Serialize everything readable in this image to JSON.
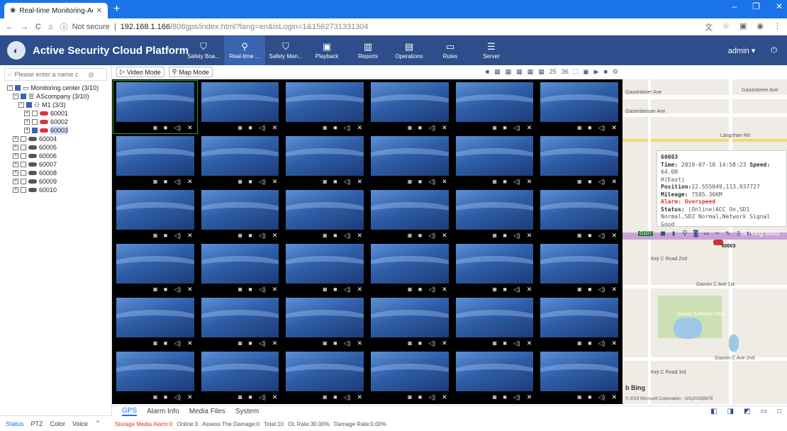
{
  "browser": {
    "tab_title": "Real-time Monitoring-Active S",
    "new_tab": "+",
    "security": "Not secure",
    "url_host": "192.168.1.166",
    "url_path": "/808gps/index.html?lang=en&isLogin=1&1562731331304"
  },
  "header": {
    "brand": "Active Security Cloud Platform",
    "nav": [
      {
        "label": "Safety Boa...",
        "icon": "shield-icon"
      },
      {
        "label": "Real-time ...",
        "icon": "location-pin-icon"
      },
      {
        "label": "Safety Man...",
        "icon": "shield-play-icon"
      },
      {
        "label": "Playback",
        "icon": "playback-icon"
      },
      {
        "label": "Reports",
        "icon": "bar-chart-icon"
      },
      {
        "label": "Operations",
        "icon": "operations-icon"
      },
      {
        "label": "Rules",
        "icon": "rules-icon"
      },
      {
        "label": "Server",
        "icon": "server-icon"
      }
    ],
    "user": "admin"
  },
  "tree": {
    "search_placeholder": "Please enter a name c",
    "root": "Monitoring center (3/10)",
    "company": "AScompany (3/10)",
    "group": "M1 (3/3)",
    "vehicles": [
      "60001",
      "60002",
      "60003",
      "60004",
      "60005",
      "60006",
      "60007",
      "60008",
      "60009",
      "60010"
    ]
  },
  "toolbar": {
    "video_mode": "Video Mode",
    "map_mode": "Map Mode",
    "layout_25": "25",
    "layout_36": "36"
  },
  "map": {
    "labels": [
      "Gaoxinbeier Ave",
      "Gaoxinbeier Ave",
      "Gaoxinbeisan Ave",
      "Langshan Rd",
      "Gaoxin C Ave 1st",
      "Gaoxin Software Park",
      "Gaoxin C Ave 2nd",
      "Keji C Road 2nd",
      "Keji C Road 3rd",
      "N Ring Blvd",
      "G107"
    ],
    "popup": {
      "id": "60003",
      "time_label": "Time:",
      "time": "2019-07-10 14:58:23",
      "speed_label": "Speed:",
      "speed": "64.00",
      "direction": "H(East)",
      "position_label": "Position:",
      "position": "22.555049,113.937727",
      "mileage_label": "Mileage:",
      "mileage": "7585.36KM",
      "alarm_label": "Alarm:",
      "alarm": "Overspeed",
      "status_label": "Status:",
      "status": "(Online)ACC On,SD1 Normal,SD2 Normal,Network Signal Good"
    },
    "marker_label": "60003",
    "provider": "Bing",
    "copyright": "© 2019 Microsoft Corporation - GS(2018)5678"
  },
  "bottom_tabs": [
    "GPS",
    "Alarm Info",
    "Media Files",
    "System"
  ],
  "left_tabs": [
    "Status",
    "PTZ",
    "Color",
    "Voice"
  ],
  "status": {
    "storage_alarm": "Storage Media Alarm:0",
    "online": "Online:3",
    "assess": "Assess The Damage:0",
    "total": "Total:10",
    "ol_rate": "OL Rate:30.00%",
    "damage_rate": "Damage Rate:0.00%"
  },
  "colors": {
    "header": "#2d4e8a",
    "accent": "#1a73e8",
    "alarm": "#dd3333"
  }
}
